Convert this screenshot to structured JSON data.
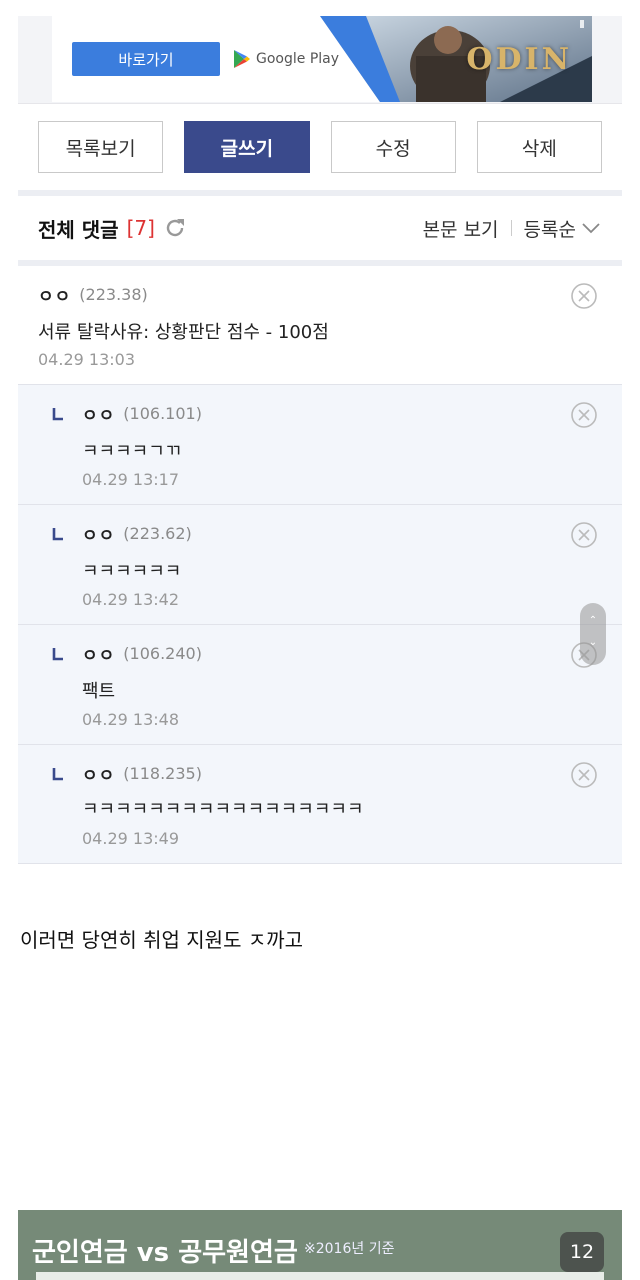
{
  "ad": {
    "go_label": "바로가기",
    "store_label": "Google Play",
    "game_logo": "ODIN"
  },
  "toolbar": {
    "list_label": "목록보기",
    "write_label": "글쓰기",
    "edit_label": "수정",
    "delete_label": "삭제"
  },
  "comments_header": {
    "title": "전체 댓글",
    "count": "[7]",
    "view_body": "본문 보기",
    "sort": "등록순"
  },
  "comments": [
    {
      "name": "ㅇㅇ",
      "ip": "(223.38)",
      "body": "서류 탈락사유: 상황판단 점수 - 100점",
      "date": "04.29 13:03",
      "reply": false
    },
    {
      "name": "ㅇㅇ",
      "ip": "(106.101)",
      "body": "ㅋㅋㅋㅋㄱㄲ",
      "date": "04.29 13:17",
      "reply": true
    },
    {
      "name": "ㅇㅇ",
      "ip": "(223.62)",
      "body": "ㅋㅋㅋㅋㅋㅋ",
      "date": "04.29 13:42",
      "reply": true
    },
    {
      "name": "ㅇㅇ",
      "ip": "(106.240)",
      "body": "팩트",
      "date": "04.29 13:48",
      "reply": true
    },
    {
      "name": "ㅇㅇ",
      "ip": "(118.235)",
      "body": "ㅋㅋㅋㅋㅋㅋㅋㅋㅋㅋㅋㅋㅋㅋㅋㅋㅋ",
      "date": "04.29 13:49",
      "reply": true
    }
  ],
  "post_text": "이러면 당연히 취업 지원도 ㅈ까고",
  "bottom_image": {
    "title": "군인연금 vs 공무원연금",
    "note": "※2016년 기준"
  },
  "page_badge": "12",
  "colors": {
    "primary": "#3a4a8c",
    "count_red": "#d33333",
    "reply_bg": "#f3f6fb",
    "bottom_green": "#768a78"
  }
}
